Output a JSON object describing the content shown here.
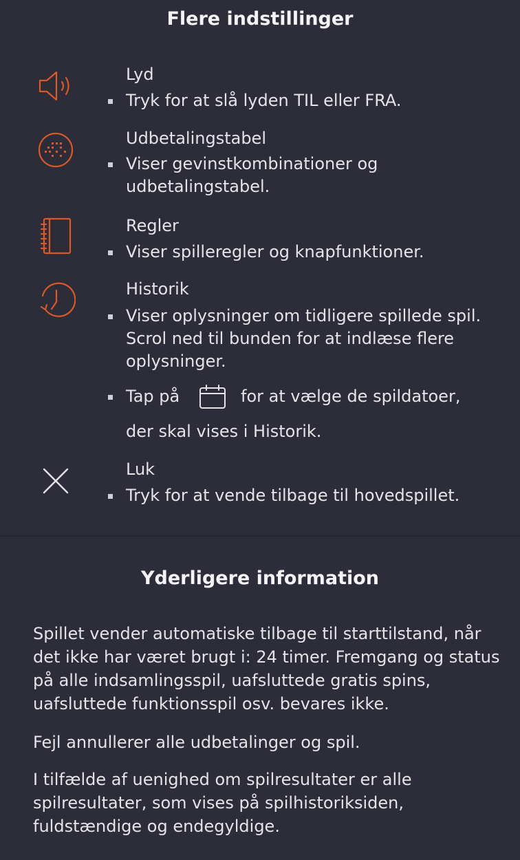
{
  "settings": {
    "title": "Flere indstillinger",
    "items": [
      {
        "icon": "speaker-icon",
        "label": "Lyd",
        "bullets": [
          "Tryk for at slå lyden TIL eller FRA."
        ]
      },
      {
        "icon": "paytable-icon",
        "label": "Udbetalingstabel",
        "bullets": [
          "Viser gevinstkombinationer og udbetalingstabel."
        ]
      },
      {
        "icon": "notebook-icon",
        "label": "Regler",
        "bullets": [
          "Viser spilleregler og knapfunktioner."
        ]
      },
      {
        "icon": "history-clock-icon",
        "label": "Historik",
        "bullets": [
          "Viser oplysninger om tidligere spillede spil. Scrol ned til bunden for at indlæse flere oplysninger."
        ],
        "calendar_tip": {
          "before": "Tap på",
          "icon": "calendar-icon",
          "after": "for at vælge de spildatoer,",
          "line2": "der skal vises i Historik."
        }
      },
      {
        "icon": "close-icon",
        "label": "Luk",
        "bullets": [
          "Tryk for at vende tilbage til hovedspillet."
        ]
      }
    ]
  },
  "info": {
    "title": "Yderligere information",
    "paragraphs": [
      "Spillet vender automatiske tilbage til starttilstand, når det ikke har været brugt i: 24 timer. Fremgang og status på alle indsamlingsspil, uafsluttede gratis spins, uafsluttede funktionsspil osv. bevares ikke.",
      "Fejl annullerer alle udbetalinger og spil.",
      "I tilfælde af uenighed om spilresultater er alle spilresultater, som vises på spilhistoriksiden, fuldstændige og endegyldige."
    ]
  },
  "colors": {
    "background": "#2c2d38",
    "accent": "#d9592a",
    "text": "#e4e4e8"
  }
}
